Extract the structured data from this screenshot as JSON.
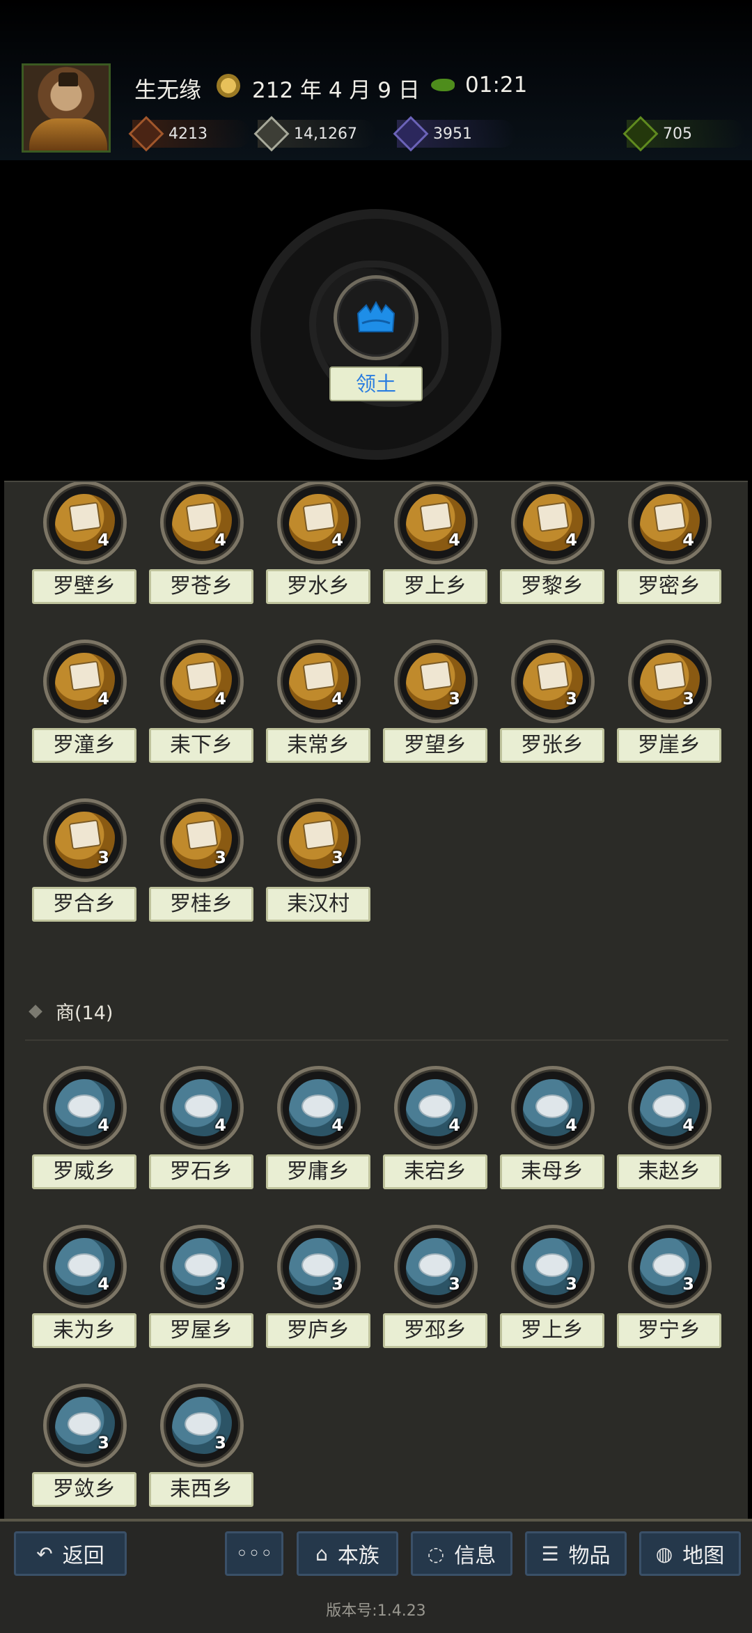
{
  "header": {
    "player_name": "生无缘",
    "date": "212 年 4 月 9 日",
    "time": "01:21",
    "resources": [
      {
        "icon": "coin-pouch-icon",
        "value": "4213",
        "color": "#a0562b"
      },
      {
        "icon": "grain-icon",
        "value": "14,1267",
        "color": "#a7a99a"
      },
      {
        "icon": "soldier-icon",
        "value": "3951",
        "color": "#6b63b8"
      },
      {
        "icon": "money-bag-icon",
        "value": "705",
        "color": "#5f8a1f"
      }
    ]
  },
  "territory_button": "领土",
  "farm_group": {
    "items": [
      {
        "name": "罗壁乡",
        "level": "4"
      },
      {
        "name": "罗苍乡",
        "level": "4"
      },
      {
        "name": "罗水乡",
        "level": "4"
      },
      {
        "name": "罗上乡",
        "level": "4"
      },
      {
        "name": "罗黎乡",
        "level": "4"
      },
      {
        "name": "罗密乡",
        "level": "4"
      },
      {
        "name": "罗潼乡",
        "level": "4"
      },
      {
        "name": "耒下乡",
        "level": "4"
      },
      {
        "name": "耒常乡",
        "level": "4"
      },
      {
        "name": "罗望乡",
        "level": "3"
      },
      {
        "name": "罗张乡",
        "level": "3"
      },
      {
        "name": "罗崖乡",
        "level": "3"
      },
      {
        "name": "罗合乡",
        "level": "3"
      },
      {
        "name": "罗桂乡",
        "level": "3"
      },
      {
        "name": "耒汉村",
        "level": "3"
      }
    ]
  },
  "trade_group": {
    "title": "商(14)",
    "items": [
      {
        "name": "罗威乡",
        "level": "4"
      },
      {
        "name": "罗石乡",
        "level": "4"
      },
      {
        "name": "罗庸乡",
        "level": "4"
      },
      {
        "name": "耒宕乡",
        "level": "4"
      },
      {
        "name": "耒母乡",
        "level": "4"
      },
      {
        "name": "耒赵乡",
        "level": "4"
      },
      {
        "name": "耒为乡",
        "level": "4"
      },
      {
        "name": "罗屋乡",
        "level": "3"
      },
      {
        "name": "罗庐乡",
        "level": "3"
      },
      {
        "name": "罗邳乡",
        "level": "3"
      },
      {
        "name": "罗上乡",
        "level": "3"
      },
      {
        "name": "罗宁乡",
        "level": "3"
      },
      {
        "name": "罗敛乡",
        "level": "3"
      },
      {
        "name": "耒西乡",
        "level": "3"
      }
    ]
  },
  "bottom_bar": {
    "back": "返回",
    "more": "◦◦◦",
    "clan": "本族",
    "info": "信息",
    "items": "物品",
    "map": "地图"
  },
  "version": "版本号:1.4.23"
}
